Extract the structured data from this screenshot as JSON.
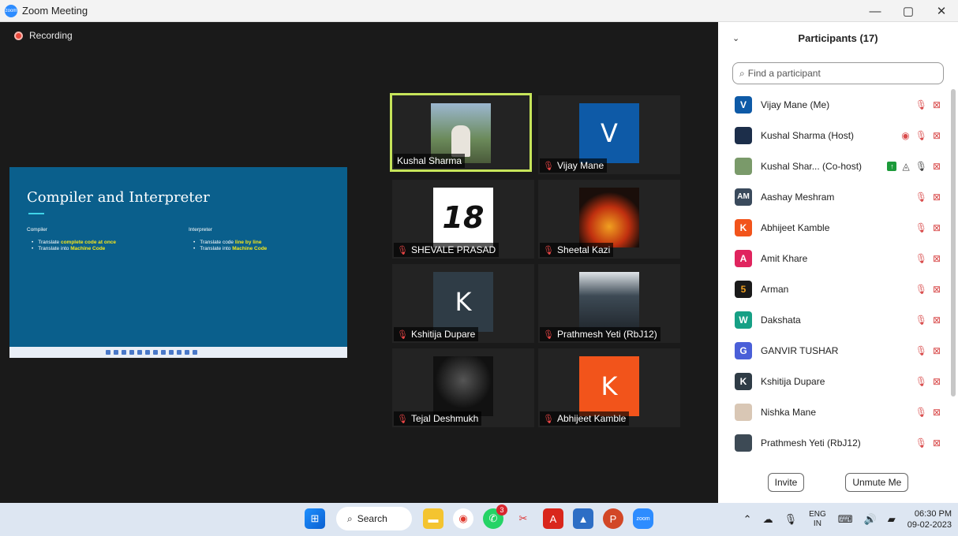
{
  "window": {
    "title": "Zoom Meeting",
    "controls": {
      "minimize": "—",
      "restore": "▢",
      "close": "✕"
    }
  },
  "meeting": {
    "recording_label": "Recording"
  },
  "slide": {
    "title": "Compiler and Interpreter",
    "left_heading": "Compiler",
    "left_items": [
      {
        "prefix": "Translate ",
        "highlight": "complete code at once"
      },
      {
        "prefix": "Translate into ",
        "highlight": "Machine Code"
      }
    ],
    "right_heading": "Interpreter",
    "right_items": [
      {
        "prefix": "Translate code ",
        "highlight": "line by line"
      },
      {
        "prefix": "Translate into ",
        "highlight": "Machine Code"
      }
    ]
  },
  "tiles": [
    {
      "name": "Kushal Sharma",
      "muted": false,
      "avatar_text": "",
      "color": "#6b8a5a"
    },
    {
      "name": "Vijay Mane",
      "muted": true,
      "avatar_text": "V",
      "color": "#0e5aa7"
    },
    {
      "name": "SHEVALE PRASAD",
      "muted": true,
      "avatar_text": "18",
      "color": "#ffffff"
    },
    {
      "name": "Sheetal Kazi",
      "muted": true,
      "avatar_text": "",
      "color": "#1a0e0a"
    },
    {
      "name": "Kshitija Dupare",
      "muted": true,
      "avatar_text": "K",
      "color": "#2f3c46"
    },
    {
      "name": "Prathmesh Yeti (RbJ12)",
      "muted": true,
      "avatar_text": "",
      "color": "#3d4a55"
    },
    {
      "name": "Tejal Deshmukh",
      "muted": true,
      "avatar_text": "",
      "color": "#111111"
    },
    {
      "name": "Abhijeet Kamble",
      "muted": true,
      "avatar_text": "K",
      "color": "#f2541b"
    }
  ],
  "panel": {
    "title": "Participants (17)",
    "search_placeholder": "Find a participant",
    "participants": [
      {
        "name": "Vijay Mane (Me)",
        "avatar": "V",
        "color": "#0e5aa7"
      },
      {
        "name": "Kushal Sharma (Host)",
        "avatar": "",
        "color": "#1c2e4a"
      },
      {
        "name": "Kushal Shar...  (Co-host)",
        "avatar": "",
        "color": "#7a9a6a"
      },
      {
        "name": "Aashay Meshram",
        "avatar": "AM",
        "color": "#3a4a5c"
      },
      {
        "name": "Abhijeet Kamble",
        "avatar": "K",
        "color": "#f2541b"
      },
      {
        "name": "Amit Khare",
        "avatar": "A",
        "color": "#e0245e"
      },
      {
        "name": "Arman",
        "avatar": "5",
        "color": "#1a1a1a"
      },
      {
        "name": "Dakshata",
        "avatar": "W",
        "color": "#16a085"
      },
      {
        "name": "GANVIR TUSHAR",
        "avatar": "G",
        "color": "#4a5fd8"
      },
      {
        "name": "Kshitija Dupare",
        "avatar": "K",
        "color": "#2f3c46"
      },
      {
        "name": "Nishka Mane",
        "avatar": "",
        "color": "#d9c7b5"
      },
      {
        "name": "Prathmesh Yeti (RbJ12)",
        "avatar": "",
        "color": "#3d4a55"
      }
    ],
    "invite_label": "Invite",
    "unmute_label": "Unmute Me"
  },
  "taskbar": {
    "search_label": "Search",
    "whatsapp_badge": "3",
    "lang_top": "ENG",
    "lang_bottom": "IN",
    "time": "06:30 PM",
    "date": "09-02-2023"
  }
}
